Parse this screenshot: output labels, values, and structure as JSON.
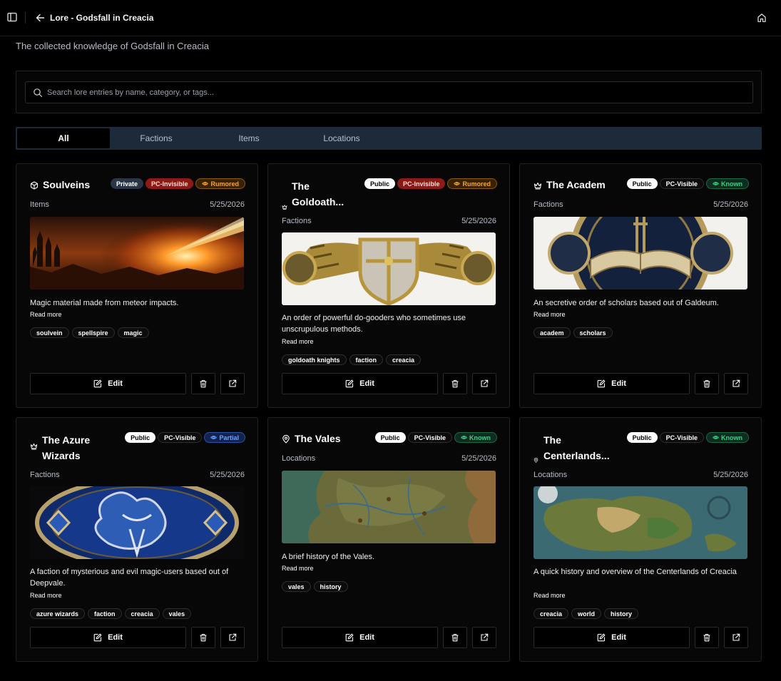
{
  "header": {
    "title": "Lore - Godsfall in Creacia"
  },
  "subtitle": "The collected knowledge of Godsfall in Creacia",
  "search": {
    "placeholder": "Search lore entries by name, category, or tags..."
  },
  "tabs": [
    {
      "label": "All",
      "active": true
    },
    {
      "label": "Factions",
      "active": false
    },
    {
      "label": "Items",
      "active": false
    },
    {
      "label": "Locations",
      "active": false
    }
  ],
  "colors": {
    "background": "#000000",
    "tab_bar": "#1d2a3a",
    "private": "#2a3647",
    "invisible": "#8e1a16",
    "rumored": "#f0a63a",
    "known": "#3fce85",
    "partial": "#6fa1ff"
  },
  "cards": [
    {
      "title": "Soulveins",
      "icon": "cube-icon",
      "badges": {
        "access": "Private",
        "pc": "PC-Invisible",
        "status": "Rumored"
      },
      "category": "Items",
      "date": "5/25/2026",
      "description": "Magic material made from meteor impacts.",
      "read_more": "Read more",
      "tags": [
        "soulvein",
        "spellspire",
        "magic"
      ],
      "edit_label": "Edit"
    },
    {
      "title": "The Goldoath...",
      "title_lines": [
        "The",
        "Goldoath..."
      ],
      "icon": "crown-icon",
      "badges": {
        "access": "Public",
        "pc": "PC-Invisible",
        "status": "Rumored"
      },
      "category": "Factions",
      "date": "5/25/2026",
      "description": "An order of powerful do-gooders who sometimes use unscrupulous methods.",
      "read_more": "Read more",
      "tags": [
        "goldoath knights",
        "faction",
        "creacia"
      ],
      "edit_label": "Edit"
    },
    {
      "title": "The Academ",
      "icon": "crown-icon",
      "badges": {
        "access": "Public",
        "pc": "PC-Visible",
        "status": "Known"
      },
      "category": "Factions",
      "date": "5/25/2026",
      "description": "An secretive order of scholars based out of Galdeum.",
      "read_more": "Read more",
      "tags": [
        "academ",
        "scholars"
      ],
      "edit_label": "Edit"
    },
    {
      "title": "The Azure Wizards",
      "title_lines": [
        "The Azure",
        "Wizards"
      ],
      "icon": "crown-icon",
      "badges": {
        "access": "Public",
        "pc": "PC-Visible",
        "status": "Partial"
      },
      "category": "Factions",
      "date": "5/25/2026",
      "description": "A faction of mysterious and evil magic-users based out of Deepvale.",
      "read_more": "Read more",
      "tags": [
        "azure wizards",
        "faction",
        "creacia",
        "vales"
      ],
      "edit_label": "Edit"
    },
    {
      "title": "The Vales",
      "icon": "map-pin-icon",
      "badges": {
        "access": "Public",
        "pc": "PC-Visible",
        "status": "Known"
      },
      "category": "Locations",
      "date": "5/25/2026",
      "description": "A brief history of the Vales.",
      "read_more": "Read more",
      "tags": [
        "vales",
        "history"
      ],
      "edit_label": "Edit"
    },
    {
      "title": "The Centerlands...",
      "title_lines": [
        "The",
        "Centerlands..."
      ],
      "icon": "map-pin-icon",
      "badges": {
        "access": "Public",
        "pc": "PC-Visible",
        "status": "Known"
      },
      "category": "Locations",
      "date": "5/25/2026",
      "description": "A quick history and overview of the Centerlands of Creacia",
      "read_more": "Read more",
      "tags": [
        "creacia",
        "world",
        "history"
      ],
      "edit_label": "Edit"
    }
  ]
}
